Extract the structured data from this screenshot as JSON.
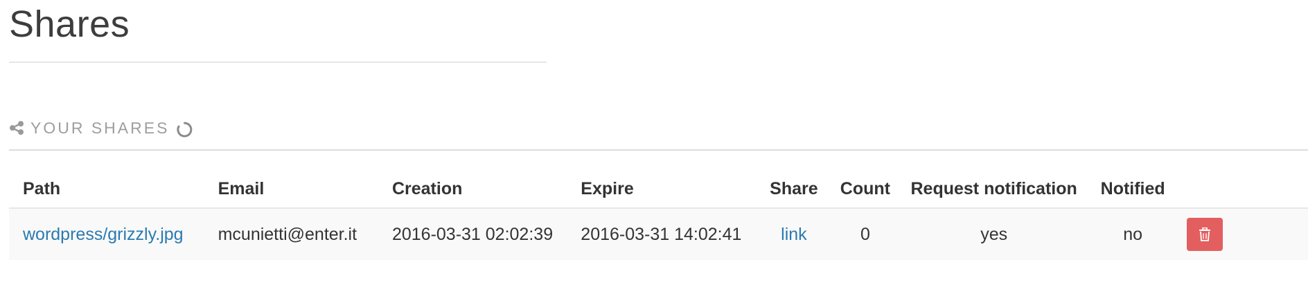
{
  "page": {
    "title": "Shares"
  },
  "section": {
    "label": "YOUR SHARES",
    "icon": "share-icon",
    "loading_icon": "spinner-icon"
  },
  "table": {
    "columns": [
      "Path",
      "Email",
      "Creation",
      "Expire",
      "Share",
      "Count",
      "Request notification",
      "Notified"
    ],
    "rows": [
      {
        "path": "wordpress/grizzly.jpg",
        "email": "mcunietti@enter.it",
        "creation": "2016-03-31 02:02:39",
        "expire": "2016-03-31 14:02:41",
        "share": "link",
        "count": "0",
        "request_notification": "yes",
        "notified": "no",
        "delete_icon": "trash-icon"
      }
    ]
  },
  "colors": {
    "link": "#2a7ab0",
    "delete_button": "#e35f5f",
    "muted": "#9e9e9e"
  }
}
